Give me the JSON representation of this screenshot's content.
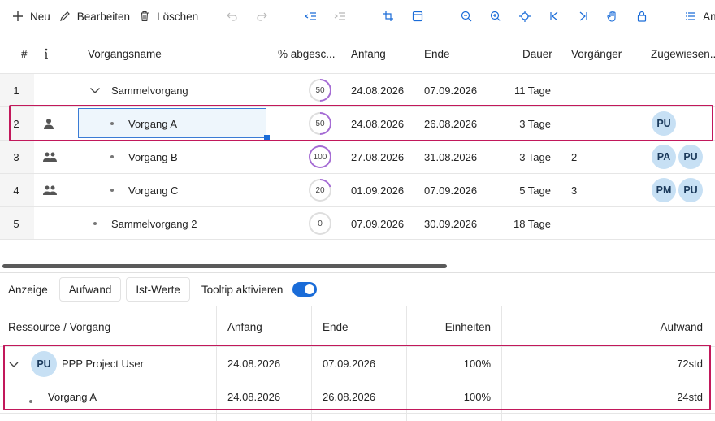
{
  "toolbar": {
    "new_label": "Neu",
    "edit_label": "Bearbeiten",
    "delete_label": "Löschen",
    "view_label": "Anzeige"
  },
  "grid": {
    "headers": {
      "num": "#",
      "name": "Vorgangsname",
      "pct": "% abgesc...",
      "start": "Anfang",
      "end": "Ende",
      "duration": "Dauer",
      "pred": "Vorgänger",
      "assigned": "Zugewiesen..."
    },
    "rows": [
      {
        "num": "1",
        "name": "Sammelvorgang",
        "pct": "50",
        "pct_value": 50,
        "start": "24.08.2026",
        "end": "07.09.2026",
        "duration": "11 Tage",
        "pred": "",
        "icon": "none",
        "avatars": []
      },
      {
        "num": "2",
        "name": "Vorgang A",
        "pct": "50",
        "pct_value": 50,
        "start": "24.08.2026",
        "end": "26.08.2026",
        "duration": "3 Tage",
        "pred": "",
        "icon": "person-icon",
        "avatars": [
          "PU"
        ]
      },
      {
        "num": "3",
        "name": "Vorgang B",
        "pct": "100",
        "pct_value": 100,
        "start": "27.08.2026",
        "end": "31.08.2026",
        "duration": "3 Tage",
        "pred": "2",
        "icon": "people-icon",
        "avatars": [
          "PA",
          "PU"
        ]
      },
      {
        "num": "4",
        "name": "Vorgang C",
        "pct": "20",
        "pct_value": 20,
        "start": "01.09.2026",
        "end": "07.09.2026",
        "duration": "5 Tage",
        "pred": "3",
        "icon": "people-icon",
        "avatars": [
          "PM",
          "PU"
        ]
      },
      {
        "num": "5",
        "name": "Sammelvorgang 2",
        "pct": "0",
        "pct_value": 0,
        "start": "07.09.2026",
        "end": "30.09.2026",
        "duration": "18 Tage",
        "pred": "",
        "icon": "none",
        "avatars": []
      }
    ]
  },
  "options": {
    "label": "Anzeige",
    "effort": "Aufwand",
    "actuals": "Ist-Werte",
    "tooltip": "Tooltip aktivieren",
    "tooltip_on": true
  },
  "resources": {
    "headers": {
      "resource": "Ressource / Vorgang",
      "start": "Anfang",
      "end": "Ende",
      "units": "Einheiten",
      "work": "Aufwand"
    },
    "rows": [
      {
        "avatar": "PU",
        "name": "PPP Project User",
        "start": "24.08.2026",
        "end": "07.09.2026",
        "units": "100%",
        "work": "72std"
      },
      {
        "avatar": "",
        "name": "Vorgang A",
        "start": "24.08.2026",
        "end": "26.08.2026",
        "units": "100%",
        "work": "24std"
      }
    ]
  },
  "colors": {
    "accent": "#1a6cd8",
    "progress": "#a56cd4",
    "selection_border": "#c2185b",
    "avatar_bg": "#c7e0f4"
  }
}
